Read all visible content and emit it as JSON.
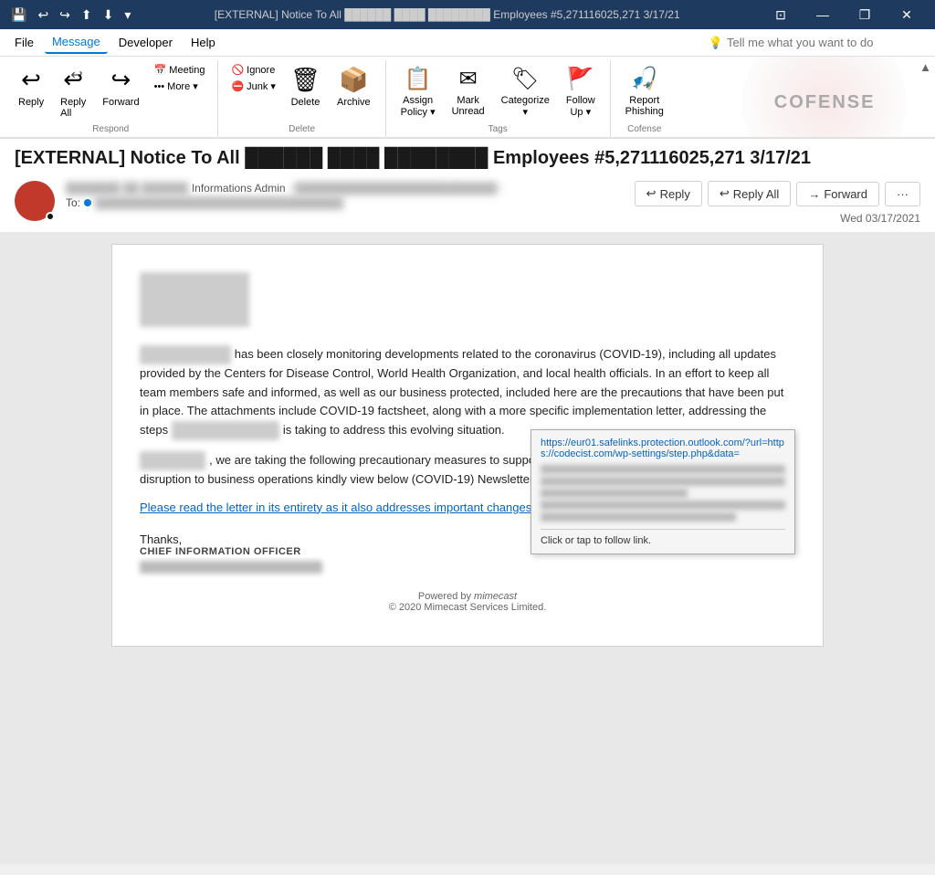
{
  "titleBar": {
    "controls": [
      "💾",
      "↩",
      "↪",
      "⬆",
      "⬇",
      "▾"
    ],
    "title": "[EXTERNAL] Notice To All ██████ ████ ████████ Employees #5,271116025,271 3/17/21",
    "winControls": [
      "⊡",
      "—",
      "❐",
      "✕"
    ]
  },
  "menuBar": {
    "items": [
      "File",
      "Message",
      "Developer",
      "Help"
    ],
    "active": "Message",
    "searchPlaceholder": "Tell me what you want to do"
  },
  "ribbon": {
    "respond": {
      "label": "Respond",
      "buttons": [
        {
          "id": "reply",
          "icon": "↩",
          "label": "Reply"
        },
        {
          "id": "reply-all",
          "icon": "↩↩",
          "label": "Reply\nAll"
        },
        {
          "id": "forward",
          "icon": "↪",
          "label": "Forward"
        }
      ],
      "smallButtons": [
        {
          "id": "meeting",
          "icon": "📅",
          "label": "Meeting"
        },
        {
          "id": "more",
          "icon": "•••",
          "label": "More ▾"
        }
      ]
    },
    "delete": {
      "label": "Delete",
      "buttons": [
        {
          "id": "ignore",
          "icon": "🚫",
          "label": "Ignore"
        },
        {
          "id": "delete",
          "icon": "🗑",
          "label": "Delete"
        },
        {
          "id": "archive",
          "icon": "📦",
          "label": "Archive"
        },
        {
          "id": "junk",
          "icon": "⛔",
          "label": "Junk ▾"
        }
      ]
    },
    "tags": {
      "label": "Tags",
      "buttons": [
        {
          "id": "assign-policy",
          "icon": "📋",
          "label": "Assign\nPolicy ▾"
        },
        {
          "id": "mark-unread",
          "icon": "✉",
          "label": "Mark\nUnread"
        },
        {
          "id": "categorize",
          "icon": "🏷",
          "label": "Categorize\n▾"
        },
        {
          "id": "follow-up",
          "icon": "🚩",
          "label": "Follow\nUp ▾"
        }
      ]
    },
    "cofense": {
      "label": "Cofense",
      "buttons": [
        {
          "id": "report-phishing",
          "icon": "🐟",
          "label": "Report\nPhishing"
        }
      ]
    }
  },
  "email": {
    "subject": "[EXTERNAL] Notice To All ██████ ████ ████████ Employees #5,271116025,271 3/17/21",
    "sender": {
      "initials": "",
      "name": "████████ ██ ████████ Informations Admin",
      "address": "<████████████████████████████>",
      "to": "To: ████████████████████████████████"
    },
    "date": "Wed 03/17/2021",
    "actions": {
      "reply": "Reply",
      "replyAll": "Reply All",
      "forward": "Forward",
      "more": "···"
    },
    "body": {
      "paragraph1": "has been closely monitoring developments related to the coronavirus (COVID-19), including all updates provided by the Centers for Disease Control, World Health Organization, and local health officials.  In an effort to keep all team members safe and informed, as well as our business protected, included here are the precautions that have been put in place. The attachments include COVID-19 factsheet,  along with a more specific implementation letter, addressing the steps",
      "paragraph1_blurred_start": "██████████",
      "paragraph1_blurred_end": "████████████",
      "paragraph1_suffix": "is taking to address this evolving situation.",
      "paragraph2_blurred": "███████",
      "paragraph2": ", we are taking the following precautionary measures to support health and safety, as well as to ensure the least disruption to business operations kindly view below (COVID-19) Newsletter for all employees and stay updated.",
      "link": "Please read the letter in its entirety as it also addresses important changes to business operations.",
      "signature": {
        "thanks": "Thanks,",
        "title": "CHIEF INFORMATION OFFICER"
      },
      "tooltip": {
        "url": "https://eur01.safelinks.protection.outlook.com/?url=https://codecist.com/wp-settings/step.php&data=",
        "action": "Click or tap to follow link."
      }
    },
    "footer": {
      "poweredBy": "Powered by",
      "brand": "mimecast",
      "copyright": "© 2020 Mimecast Services Limited."
    }
  },
  "cofenseLogo": {
    "text": "COFENSE"
  }
}
